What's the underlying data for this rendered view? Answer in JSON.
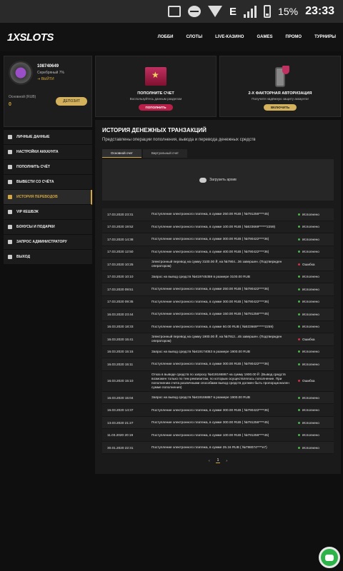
{
  "statusbar": {
    "battery": "15%",
    "time": "23:33",
    "network": "E"
  },
  "header": {
    "logo_main": "1X",
    "logo_accent": "SLOTS",
    "nav": [
      "ЛОББИ",
      "СЛОТЫ",
      "LIVE-КАЗИНО",
      "GAMES",
      "ПРОМО",
      "ТУРНИРЫ"
    ]
  },
  "profile": {
    "id": "108740649",
    "level": "Серебряный 7%",
    "logout": "ВЫЙТИ",
    "balance_label": "Основной (RUB)",
    "balance_value": "0",
    "deposit": "ДЕПОЗИТ"
  },
  "sidebar": {
    "items": [
      {
        "label": "ЛИЧНЫЕ ДАННЫЕ",
        "icon": "user-icon"
      },
      {
        "label": "НАСТРОЙКИ АККАУНТА",
        "icon": "settings-icon"
      },
      {
        "label": "ПОПОЛНИТЬ СЧЁТ",
        "icon": "deposit-icon"
      },
      {
        "label": "ВЫВЕСТИ СО СЧЁТА",
        "icon": "withdraw-icon"
      },
      {
        "label": "ИСТОРИЯ ПЕРЕВОДОВ",
        "icon": "transfer-icon"
      },
      {
        "label": "VIP КЕШБЭК",
        "icon": "vip-icon"
      },
      {
        "label": "БОНУСЫ И ПОДАРКИ",
        "icon": "gift-icon"
      },
      {
        "label": "ЗАПРОС АДМИНИСТРАТОРУ",
        "icon": "mail-icon"
      },
      {
        "label": "ВЫХОД",
        "icon": "exit-icon"
      }
    ]
  },
  "cards": {
    "deposit": {
      "title": "ПОПОЛНИТЕ СЧЕТ",
      "subtitle": "Воспользуйтесь данным разделом",
      "button": "ПОПОЛНИТЬ"
    },
    "twofa": {
      "title": "2-Х ФАКТОРНАЯ АВТОРИЗАЦИЯ",
      "subtitle": "Получите надёжную защиту аккаунта!",
      "button": "ВКЛЮЧИТЬ"
    }
  },
  "history": {
    "title": "ИСТОРИЯ ДЕНЕЖНЫХ ТРАНЗАКЦИЙ",
    "subtitle": "Представлены операции пополнения, вывода и перевода денежных средств",
    "tabs": [
      "Основной счет",
      "Виртуальный счет"
    ],
    "upload": "Загрузить архив",
    "rows": [
      {
        "date": "17.03.2020 23:31",
        "desc": "Поступление электронного платежа, в сумме 250.00 RUB ( №791256****45)",
        "status": "Исполнено",
        "ok": true
      },
      {
        "date": "17.03.2020 19:52",
        "desc": "Поступление электронного платежа, в сумме 100.00 RUB ( №533669******2259)",
        "status": "Исполнено",
        "ok": true
      },
      {
        "date": "17.03.2020 14:38",
        "desc": "Поступление электронного платежа, в сумме 300.00 RUB ( №790422****36)",
        "status": "Исполнено",
        "ok": true
      },
      {
        "date": "17.03.2020 12:50",
        "desc": "Поступление электронного платежа, в сумме 400.00 RUB ( №790422****36)",
        "status": "Исполнено",
        "ok": true
      },
      {
        "date": "17.03.2020 10:25",
        "desc": "Электронный перевод на сумму 3100.00 ₽, на №7904...36 завершен. (Подтвержден оператором)",
        "status": "Ошибка",
        "ok": false
      },
      {
        "date": "17.03.2020 10:10",
        "desc": "Запрос на вывод средств №419745359 в размере 3100.00 RUB",
        "status": "Исполнено",
        "ok": true
      },
      {
        "date": "17.03.2020 09:51",
        "desc": "Поступление электронного платежа, в сумме 250.00 RUB ( №790422****36)",
        "status": "Исполнено",
        "ok": true
      },
      {
        "date": "17.03.2020 09:35",
        "desc": "Поступление электронного платежа, в сумме 300.00 RUB ( №790422****36)",
        "status": "Исполнено",
        "ok": true
      },
      {
        "date": "16.03.2020 23:44",
        "desc": "Поступление электронного платежа, в сумме 150.00 RUB ( №791256****45)",
        "status": "Исполнено",
        "ok": true
      },
      {
        "date": "16.03.2020 18:33",
        "desc": "Поступление электронного платежа, в сумме 50.00 RUB ( №533669******2259)",
        "status": "Исполнено",
        "ok": true
      },
      {
        "date": "16.03.2020 15:41",
        "desc": "Электронный перевод на сумму 1900.00 ₽, на №7912...45 завершен. (Подтвержден оператором)",
        "status": "Ошибка",
        "ok": false
      },
      {
        "date": "16.03.2020 15:15",
        "desc": "Запрос на вывод средств №419174053 в размере 1900.00 RUB",
        "status": "Исполнено",
        "ok": true
      },
      {
        "date": "16.03.2020 15:11",
        "desc": "Поступление электронного платежа, в сумме 300.00 RUB ( №790422****36)",
        "status": "Исполнено",
        "ok": true
      },
      {
        "date": "16.03.2020 15:10",
        "desc": "Отказ в выводе средств по запросу №419166867 на сумму 1900.00 ₽. (Вывод средств возможен только по тем реквизитам, по которым осуществлялось пополнение. При пополнении счета различными способами вывод средств должен быть пропорционален сумме пополнения)",
        "status": "Ошибка",
        "ok": false
      },
      {
        "date": "16.03.2020 15:04",
        "desc": "Запрос на вывод средств №419166867 в размере 1900.00 RUB",
        "status": "Исполнено",
        "ok": true
      },
      {
        "date": "16.03.2020 14:37",
        "desc": "Поступление электронного платежа, в сумме 300.00 RUB ( №790422****36)",
        "status": "Исполнено",
        "ok": true
      },
      {
        "date": "13.03.2020 21:27",
        "desc": "Поступление электронного платежа, в сумме 300.00 RUB ( №791256****45)",
        "status": "Исполнено",
        "ok": true
      },
      {
        "date": "11.03.2020 20:19",
        "desc": "Поступление электронного платежа, в сумме 100.00 RUB ( №791256****45)",
        "status": "Исполнено",
        "ok": true
      },
      {
        "date": "30.01.2020 22:31",
        "desc": "Поступление электронного платежа, в сумме 25.16 RUB ( №798074****e7)",
        "status": "Исполнено",
        "ok": true
      }
    ],
    "pager": {
      "prev": "‹",
      "page": "1",
      "next": "›"
    }
  },
  "colors": {
    "accent": "#d4a63c",
    "success": "#4ab54a",
    "error": "#d03040",
    "chat": "#2db34a"
  }
}
